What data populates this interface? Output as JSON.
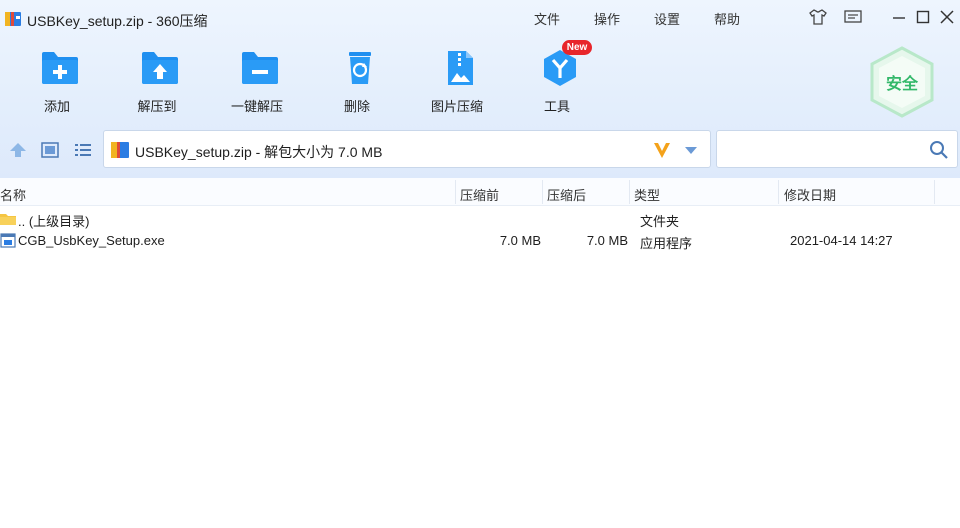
{
  "window": {
    "title": "USBKey_setup.zip - 360压缩"
  },
  "menu": {
    "items": [
      "文件",
      "操作",
      "设置",
      "帮助"
    ]
  },
  "toolbar": {
    "items": [
      {
        "label": "添加",
        "icon": "add-folder-icon"
      },
      {
        "label": "解压到",
        "icon": "extract-to-icon"
      },
      {
        "label": "一键解压",
        "icon": "one-click-extract-icon"
      },
      {
        "label": "删除",
        "icon": "delete-icon"
      },
      {
        "label": "图片压缩",
        "icon": "image-compress-icon"
      },
      {
        "label": "工具",
        "icon": "tools-icon"
      }
    ],
    "new_badge": "New",
    "safe_badge": "安全"
  },
  "address": {
    "path_text": "USBKey_setup.zip - 解包大小为 7.0 MB"
  },
  "search": {
    "placeholder": ""
  },
  "list": {
    "columns": [
      "名称",
      "压缩前",
      "压缩后",
      "类型",
      "修改日期"
    ],
    "rows": [
      {
        "name": ".. (上级目录)",
        "before": "",
        "after": "",
        "type": "文件夹",
        "date": "",
        "icon": "folder-icon"
      },
      {
        "name": "CGB_UsbKey_Setup.exe",
        "before": "7.0 MB",
        "after": "7.0 MB",
        "type": "应用程序",
        "date": "2021-04-14 14:27",
        "icon": "exe-file-icon"
      }
    ]
  },
  "colors": {
    "accent_blue": "#1f8ff0",
    "safe_green": "#33b86a",
    "new_red": "#e8262b",
    "v_orange": "#f4a21a"
  }
}
